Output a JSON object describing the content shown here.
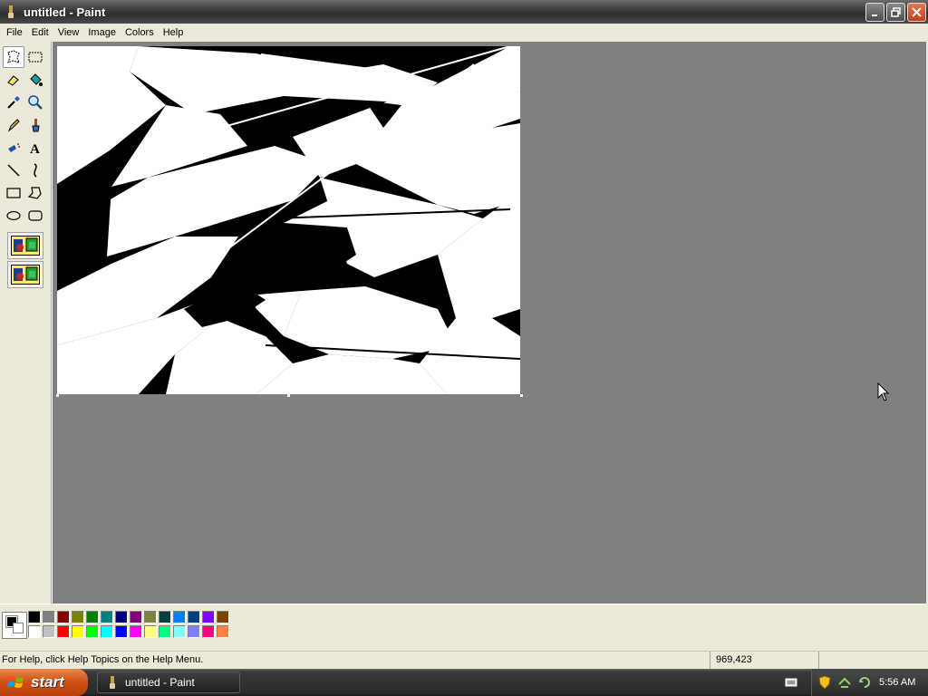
{
  "window": {
    "title": "untitled - Paint"
  },
  "menu": [
    "File",
    "Edit",
    "View",
    "Image",
    "Colors",
    "Help"
  ],
  "tools": [
    {
      "name": "free-form-select-icon",
      "active": true
    },
    {
      "name": "select-icon"
    },
    {
      "name": "eraser-icon"
    },
    {
      "name": "fill-with-color-icon"
    },
    {
      "name": "pick-color-icon"
    },
    {
      "name": "magnifier-icon"
    },
    {
      "name": "pencil-icon"
    },
    {
      "name": "brush-icon"
    },
    {
      "name": "airbrush-icon"
    },
    {
      "name": "text-icon"
    },
    {
      "name": "line-icon"
    },
    {
      "name": "curve-icon"
    },
    {
      "name": "rectangle-icon"
    },
    {
      "name": "polygon-icon"
    },
    {
      "name": "ellipse-icon"
    },
    {
      "name": "rounded-rectangle-icon"
    }
  ],
  "palette": {
    "row1": [
      "#000000",
      "#808080",
      "#800000",
      "#808000",
      "#008000",
      "#008080",
      "#000080",
      "#800080",
      "#808040",
      "#004040",
      "#0080ff",
      "#004080",
      "#8000ff",
      "#804000"
    ],
    "row2": [
      "#ffffff",
      "#c0c0c0",
      "#ff0000",
      "#ffff00",
      "#00ff00",
      "#00ffff",
      "#0000ff",
      "#ff00ff",
      "#ffff80",
      "#00ff80",
      "#80ffff",
      "#8080ff",
      "#ff0080",
      "#ff8040"
    ],
    "foreground": "#000000",
    "background": "#ffffff"
  },
  "status": {
    "help": "For Help, click Help Topics on the Help Menu.",
    "coords": "969,423"
  },
  "taskbar": {
    "start": "start",
    "task": "untitled - Paint",
    "clock": "5:56 AM"
  }
}
